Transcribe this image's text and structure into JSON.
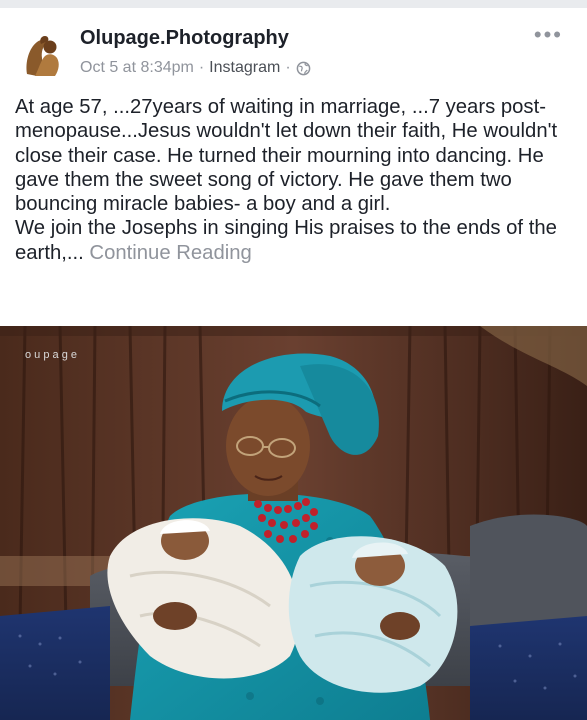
{
  "post": {
    "author": "Olupage.Photography",
    "date": "Oct 5 at 8:34pm",
    "separator": "·",
    "source": "Instagram",
    "separator2": "·",
    "more_label": "•••",
    "paragraph1": "At age 57, ...27years of waiting in marriage, ...7 years post-menopause...Jesus wouldn't let down their faith, He wouldn't close their case. He turned their mourning into dancing. He gave them the sweet song of victory. He gave them two bouncing miracle babies- a boy and a girl.",
    "paragraph2_text": "We join the Josephs in singing His praises to the ends of the earth,...",
    "continue_label": "Continue Reading"
  },
  "photo": {
    "watermark": "o   u   p   a   g   e"
  },
  "icons": {
    "more": "more-options-icon",
    "privacy": "globe-icon",
    "avatar": "page-avatar"
  }
}
